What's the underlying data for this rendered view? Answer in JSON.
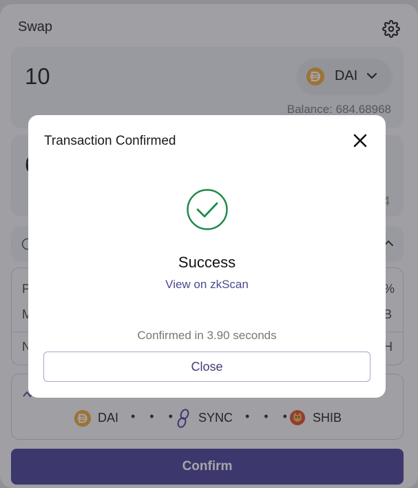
{
  "header": {
    "title": "Swap",
    "settings_icon": "gear-icon"
  },
  "from": {
    "amount": "10",
    "token": {
      "symbol": "DAI",
      "icon": "dai-coin-icon"
    },
    "balance": "Balance: 684.68968"
  },
  "to": {
    "amount_partial": "6",
    "balance_partial": "4"
  },
  "details": {
    "row1_left": "P",
    "row1_right": "%",
    "row2_left": "M",
    "row2_right": "B",
    "row3_left": "N",
    "row3_right": "H"
  },
  "route": {
    "items": [
      {
        "symbol": "DAI",
        "icon": "dai-coin-icon"
      },
      {
        "symbol": "SYNC",
        "icon": "sync-link-icon"
      },
      {
        "symbol": "SHIB",
        "icon": "shib-coin-icon"
      }
    ],
    "separator": "• • •"
  },
  "confirm_button": "Confirm",
  "modal": {
    "title": "Transaction Confirmed",
    "status": "Success",
    "link": "View on zkScan",
    "confirmed_in": "Confirmed in 3.90 seconds",
    "close_label": "Close"
  },
  "colors": {
    "accent": "#4b4298",
    "success_green": "#1f8a4c",
    "dai_orange": "#f0a93a",
    "link": "#4b4a8e"
  }
}
